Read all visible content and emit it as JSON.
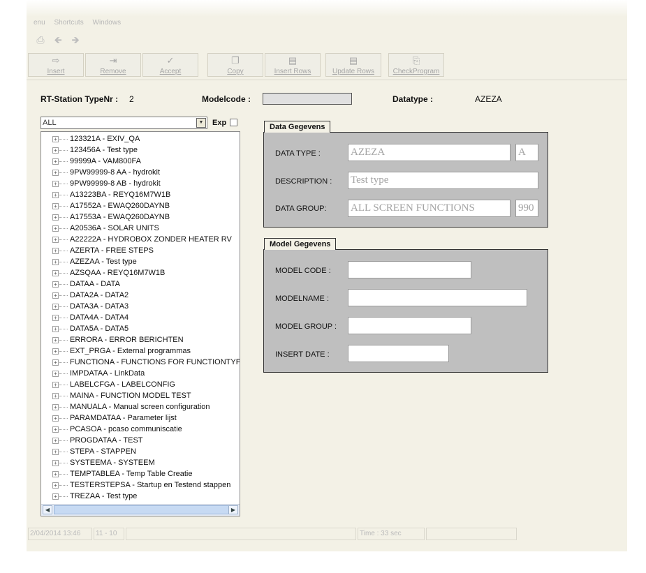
{
  "menu": [
    "enu",
    "Shortcuts",
    "Windows"
  ],
  "toolbar": {
    "insert": "Insert",
    "remove": "Remove",
    "accept": "Accept",
    "copy": "Copy",
    "insert_rows": "Insert Rows",
    "update_rows": "Update Rows",
    "check_program": "CheckProgram"
  },
  "header": {
    "station_label": "RT-Station TypeNr :",
    "station_value": "2",
    "modelcode_label": "Modelcode :",
    "modelcode_value": "",
    "datatype_label": "Datatype :",
    "datatype_value": "AZEZA"
  },
  "filter": {
    "value": "ALL",
    "exp_label": "Exp"
  },
  "tree_items": [
    "123321A - EXIV_QA",
    "123456A - Test type",
    "99999A - VAM800FA",
    "9PW99999-8 AA - hydrokit",
    "9PW99999-8 AB - hydrokit",
    "A13223BA - REYQ16M7W1B",
    "A17552A - EWAQ260DAYNB",
    "A17553A - EWAQ260DAYNB",
    "A20536A - SOLAR UNITS",
    "A22222A - HYDROBOX ZONDER HEATER RV",
    "AZERTA - FREE  STEPS",
    "AZEZAA - Test type",
    "AZSQAA - REYQ16M7W1B",
    "DATAA - DATA",
    "DATA2A - DATA2",
    "DATA3A - DATA3",
    "DATA4A - DATA4",
    "DATA5A - DATA5",
    "ERRORA - ERROR BERICHTEN",
    "EXT_PRGA - External programmas",
    "FUNCTIONA - FUNCTIONS FOR FUNCTIONTYPE",
    "IMPDATAA - LinkData",
    "LABELCFGA - LABELCONFIG",
    "MAINA - FUNCTION MODEL TEST",
    "MANUALA - Manual screen configuration",
    "PARAMDATAA - Parameter lijst",
    "PCASOA - pcaso communiscatie",
    "PROGDATAA - TEST",
    "STEPA - STAPPEN",
    "SYSTEEMA - SYSTEEM",
    "TEMPTABLEA - Temp Table Creatie",
    "TESTERSTEPSA - Startup en Testend stappen",
    "TREZAA - Test type"
  ],
  "data_gegevens": {
    "title": "Data Gegevens",
    "data_type_label": "DATA TYPE :",
    "data_type_value": "AZEZA",
    "data_type_suffix": "A",
    "description_label": "DESCRIPTION :",
    "description_value": "Test type",
    "data_group_label": "DATA GROUP:",
    "data_group_value": "ALL SCREEN FUNCTIONS",
    "data_group_code": "990"
  },
  "model_gegevens": {
    "title": "Model Gegevens",
    "model_code_label": "MODEL CODE :",
    "model_code_value": "",
    "modelname_label": "MODELNAME :",
    "modelname_value": "",
    "model_group_label": "MODEL GROUP :",
    "model_group_value": "",
    "insert_date_label": "INSERT DATE :",
    "insert_date_value": ""
  },
  "status": {
    "datetime": "2/04/2014 13:46",
    "code": "11 - 10",
    "time": "Time : 33 sec"
  },
  "icons": {
    "print": "print-icon",
    "back": "arrow-left-icon",
    "forward": "arrow-right-icon",
    "insert": "insert-icon",
    "remove": "remove-icon",
    "accept": "check-icon",
    "copy": "copy-icon",
    "insert_rows": "insert-rows-icon",
    "update_rows": "update-rows-icon",
    "check_program": "check-program-icon"
  }
}
